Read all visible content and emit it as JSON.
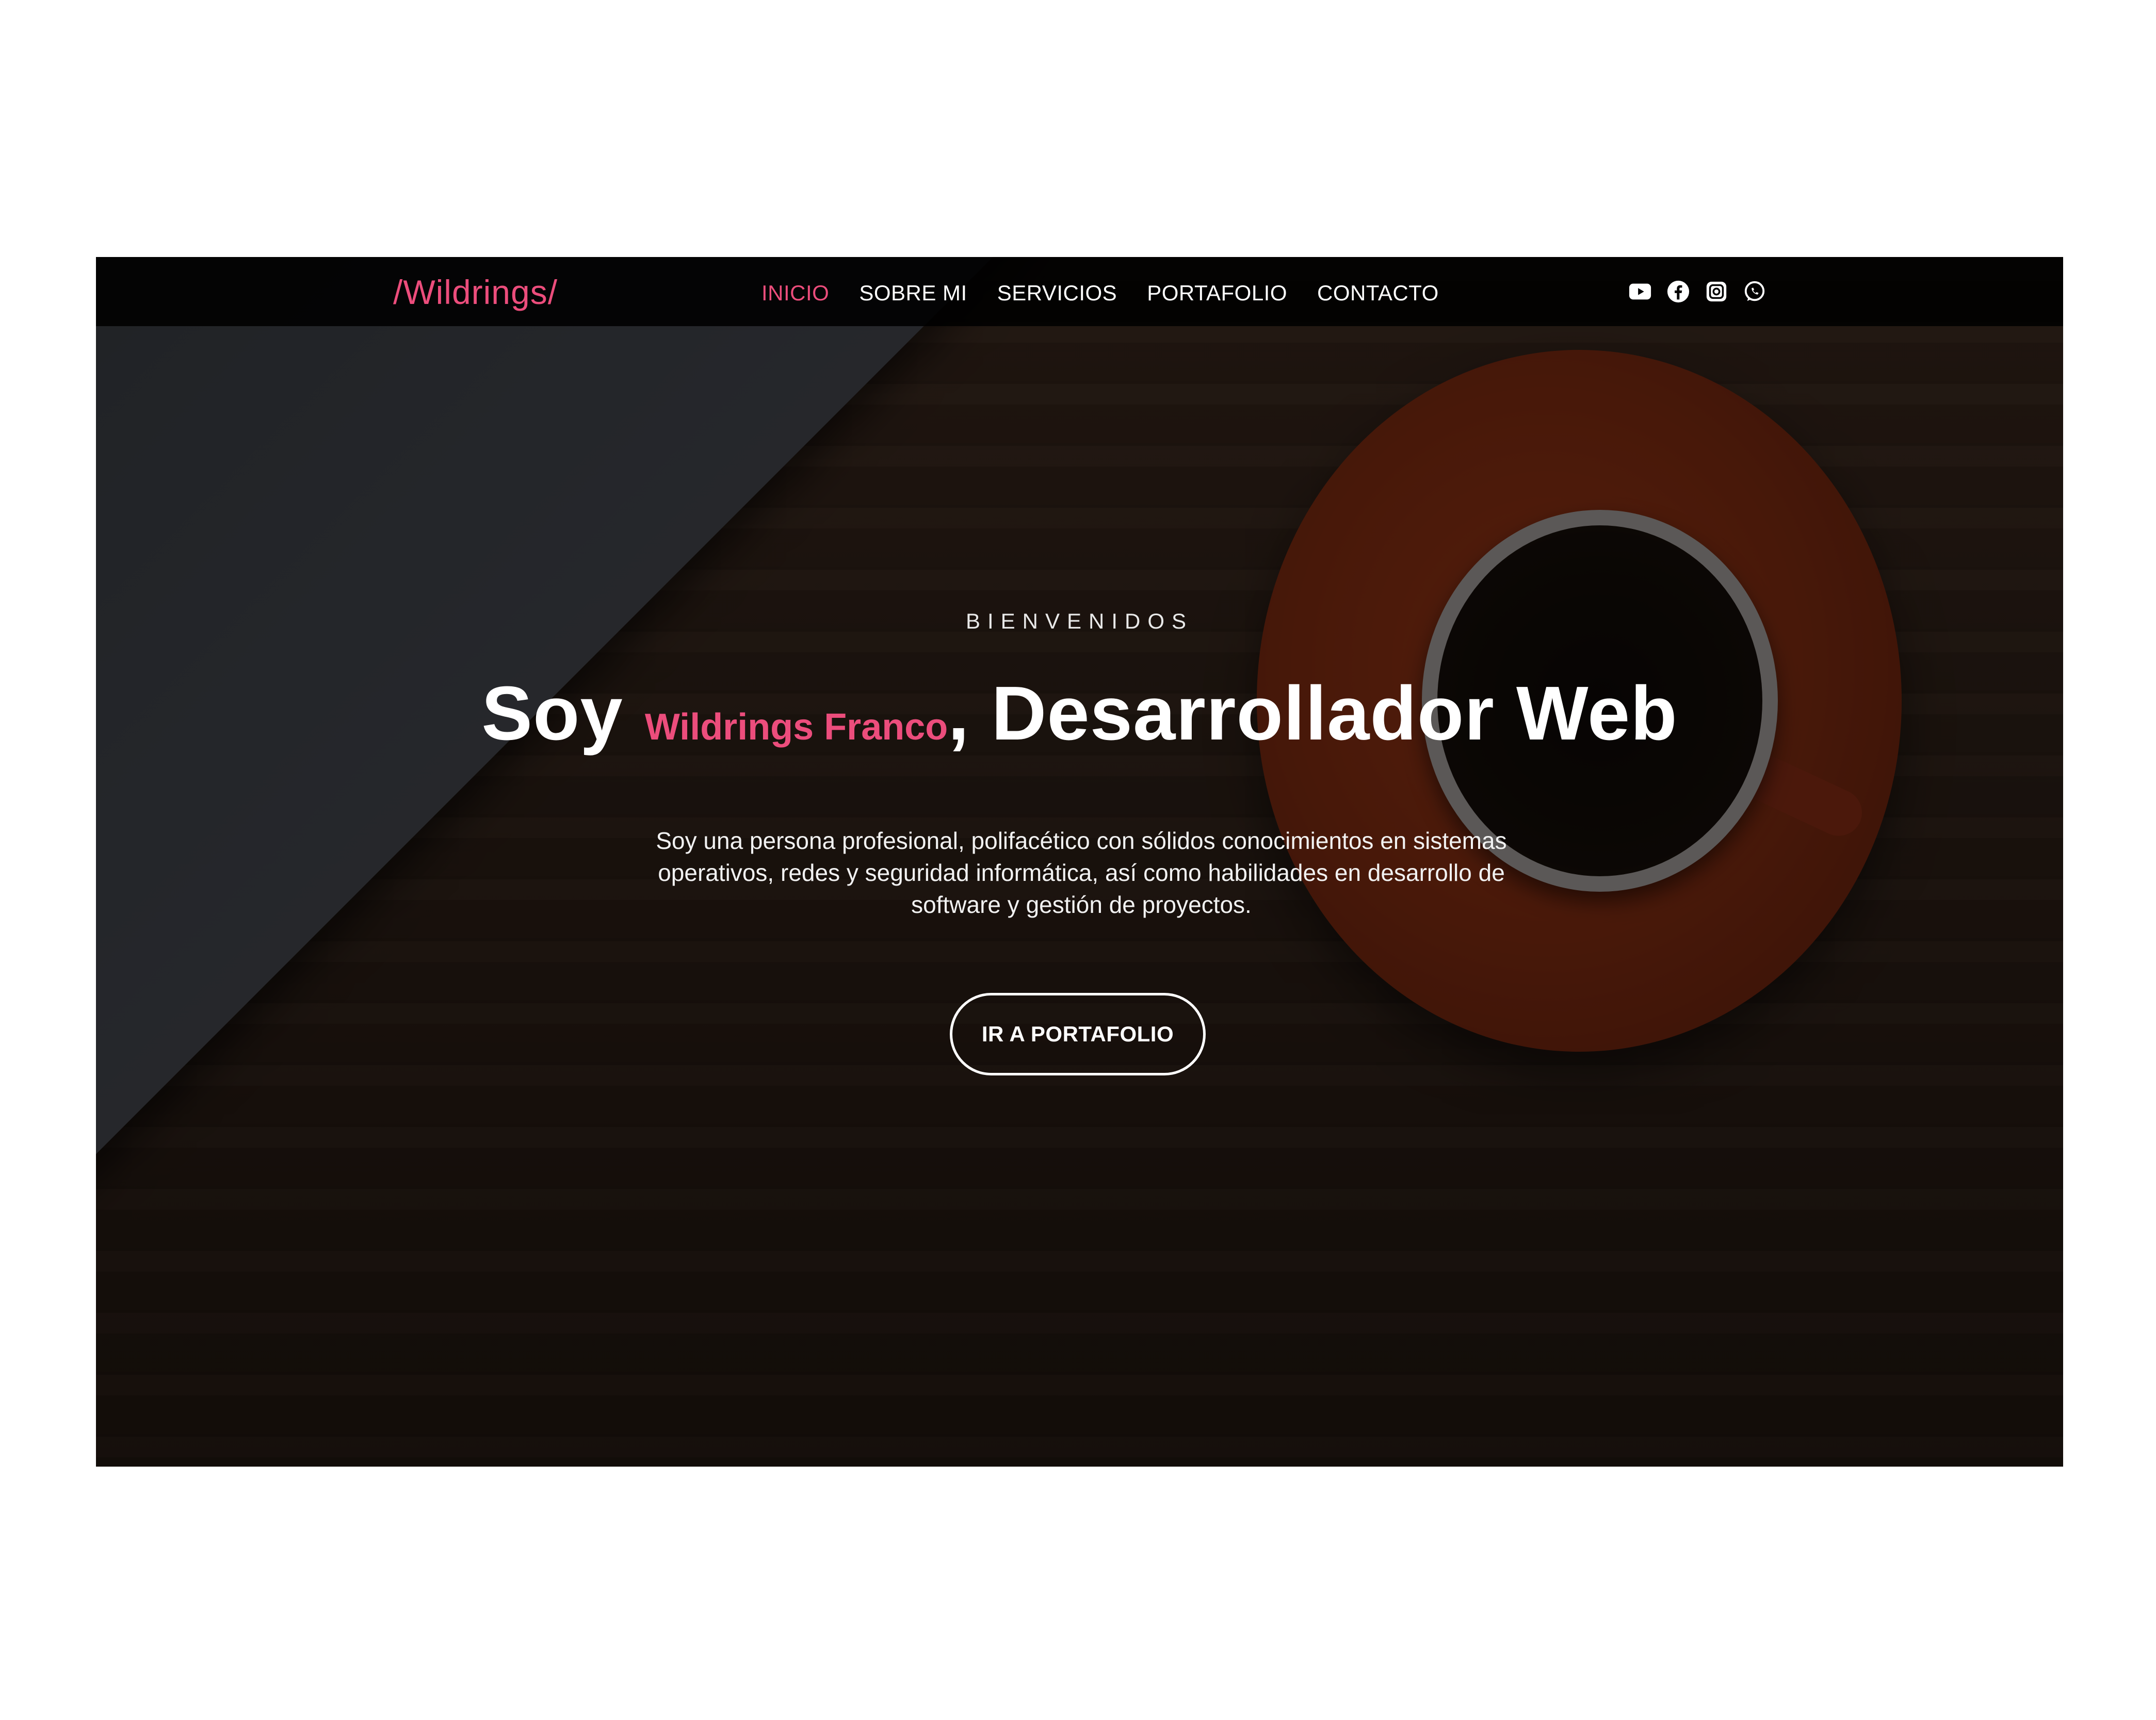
{
  "navbar": {
    "brand": "/Wildrings/",
    "links": [
      {
        "label": "INICIO",
        "active": true
      },
      {
        "label": "SOBRE MI",
        "active": false
      },
      {
        "label": "SERVICIOS",
        "active": false
      },
      {
        "label": "PORTAFOLIO",
        "active": false
      },
      {
        "label": "CONTACTO",
        "active": false
      }
    ],
    "social_icons": [
      "youtube-icon",
      "facebook-icon",
      "instagram-icon",
      "whatsapp-icon"
    ]
  },
  "hero": {
    "eyebrow": "BIENVENIDOS",
    "headline_prefix": "Soy ",
    "headline_name": "Wildrings Franco",
    "headline_suffix": ", Desarrollador Web",
    "description": "Soy una persona profesional, polifacético con sólidos conocimientos en sistemas operativos, redes y seguridad informática, así como habilidades en desarrollo de software y gestión de proyectos.",
    "cta_label": "IR A PORTAFOLIO"
  },
  "colors": {
    "accent": "#ec4d7c",
    "navbar_bg": "#000000",
    "text": "#ffffff"
  }
}
